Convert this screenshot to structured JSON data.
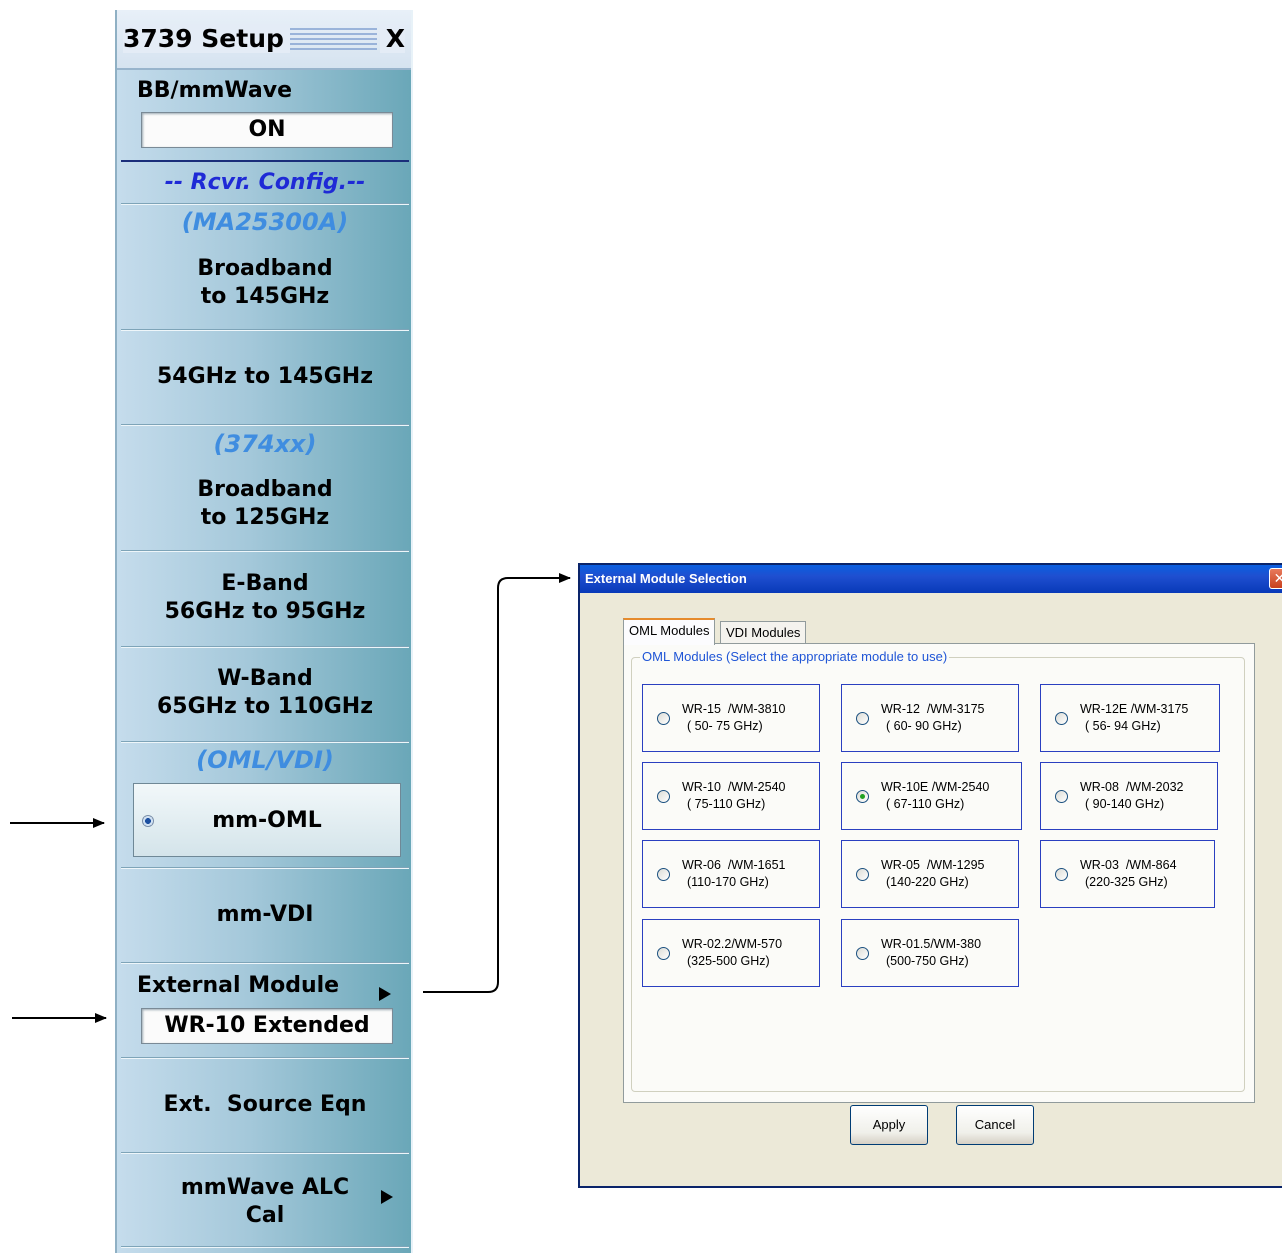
{
  "panel": {
    "title": "3739 Setup",
    "close_label": "X",
    "bb_mmwave": {
      "label": "BB/mmWave",
      "value": "ON"
    },
    "rcvr_config_heading": "-- Rcvr. Config.--",
    "ma_group": "(MA25300A)",
    "broadband_145": [
      "Broadband",
      "to 145GHz"
    ],
    "range_54_145": "54GHz to 145GHz",
    "group_374": "(374xx)",
    "broadband_125": [
      "Broadband",
      "to 125GHz"
    ],
    "e_band": [
      "E-Band",
      "56GHz to 95GHz"
    ],
    "w_band": [
      "W-Band",
      "65GHz to 110GHz"
    ],
    "oml_vdi_group": "(OML/VDI)",
    "mm_oml": "mm-OML",
    "mm_vdi": "mm-VDI",
    "external_module": {
      "label": "External Module",
      "value": "WR-10 Extended"
    },
    "ext_source_eqn": "Ext.  Source Eqn",
    "mmwave_alc_cal": [
      "mmWave ALC",
      "Cal"
    ]
  },
  "dialog": {
    "title": "External Module Selection",
    "close_label": "✕",
    "tabs": [
      {
        "label": "OML Modules",
        "active": true
      },
      {
        "label": "VDI Modules",
        "active": false
      }
    ],
    "group_label": "OML Modules (Select the appropriate module to use)",
    "modules": [
      {
        "line1": "WR-15  /WM-3810",
        "line2": "( 50- 75 GHz)",
        "selected": false
      },
      {
        "line1": "WR-12  /WM-3175",
        "line2": "( 60- 90 GHz)",
        "selected": false
      },
      {
        "line1": "WR-12E /WM-3175",
        "line2": "( 56- 94 GHz)",
        "selected": false
      },
      {
        "line1": "WR-10  /WM-2540",
        "line2": "( 75-110 GHz)",
        "selected": false
      },
      {
        "line1": "WR-10E /WM-2540",
        "line2": "( 67-110 GHz)",
        "selected": true
      },
      {
        "line1": "WR-08  /WM-2032",
        "line2": "( 90-140 GHz)",
        "selected": false
      },
      {
        "line1": "WR-06  /WM-1651",
        "line2": "(110-170 GHz)",
        "selected": false
      },
      {
        "line1": "WR-05  /WM-1295",
        "line2": "(140-220 GHz)",
        "selected": false
      },
      {
        "line1": "WR-03  /WM-864",
        "line2": "(220-325 GHz)",
        "selected": false
      },
      {
        "line1": "WR-02.2/WM-570",
        "line2": "(325-500 GHz)",
        "selected": false
      },
      {
        "line1": "WR-01.5/WM-380",
        "line2": "(500-750 GHz)",
        "selected": false
      }
    ],
    "apply_label": "Apply",
    "cancel_label": "Cancel"
  }
}
